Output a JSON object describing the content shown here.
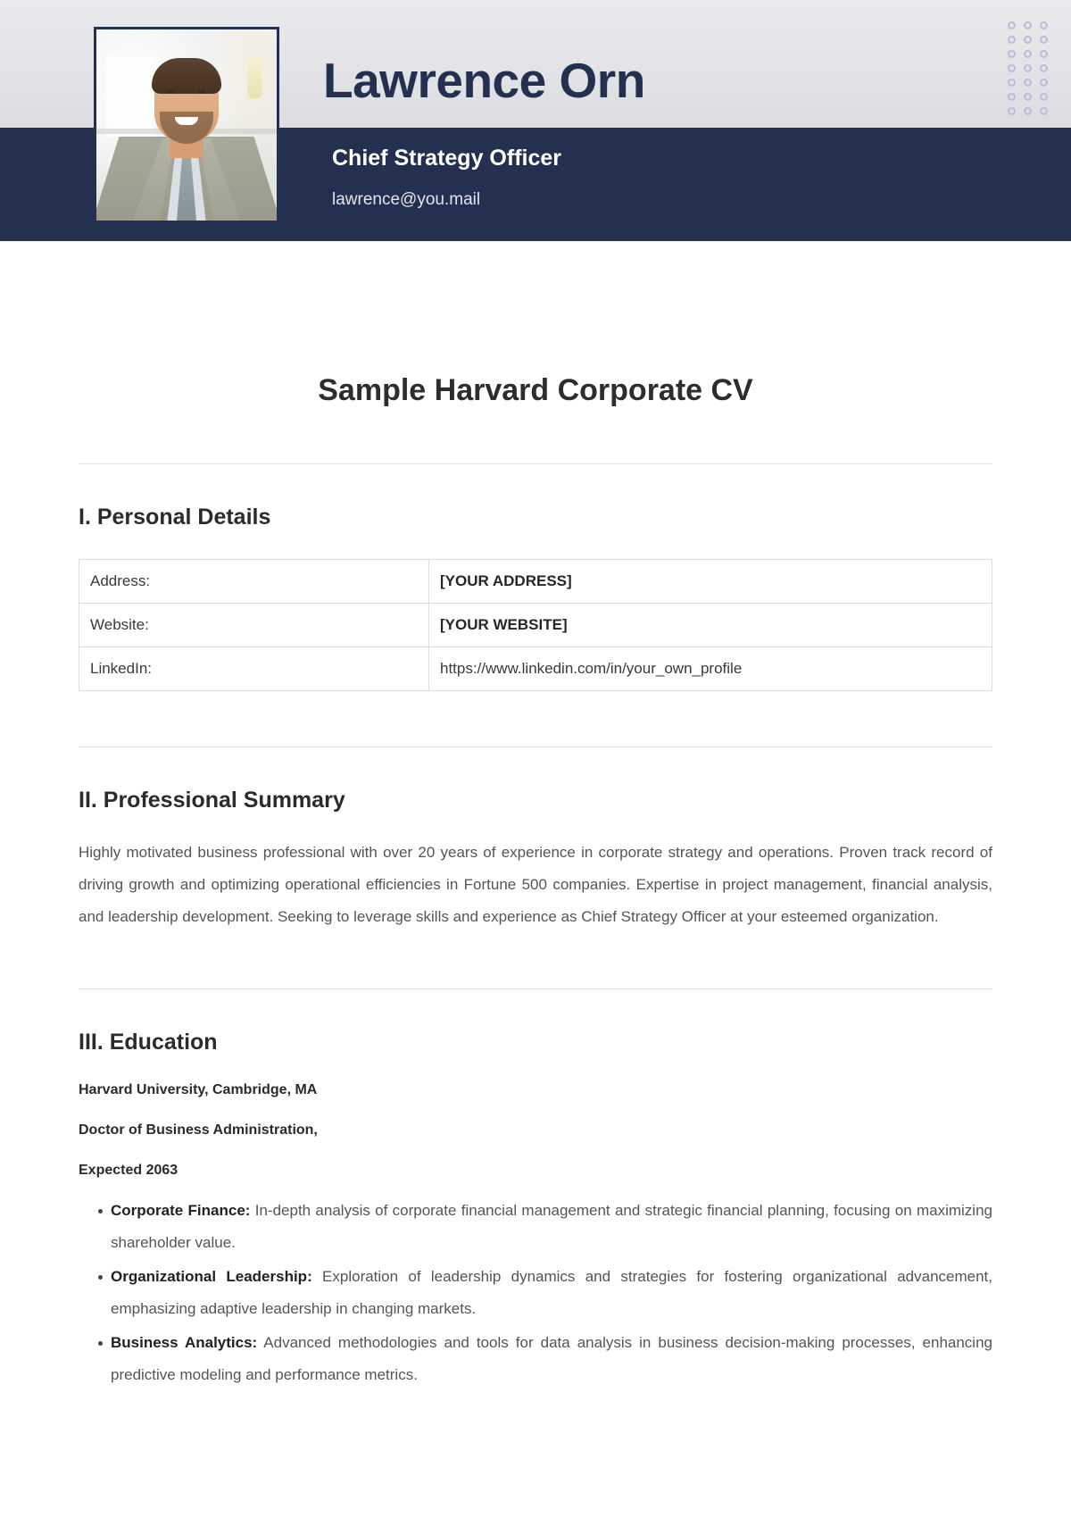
{
  "header": {
    "name": "Lawrence Orn",
    "role": "Chief Strategy Officer",
    "email": "lawrence@you.mail",
    "accent_navy": "#24304f",
    "dot_color": "#c8b4d6",
    "dot_rows": 7,
    "dot_cols": 3
  },
  "document": {
    "title": "Sample Harvard Corporate CV"
  },
  "sections": {
    "personal_details": {
      "heading": "I. Personal Details",
      "rows": [
        {
          "label": "Address:",
          "value": "[YOUR ADDRESS]",
          "bold": true
        },
        {
          "label": "Website:",
          "value": "[YOUR WEBSITE]",
          "bold": true
        },
        {
          "label": "LinkedIn:",
          "value": "https://www.linkedin.com/in/your_own_profile",
          "bold": false
        }
      ]
    },
    "professional_summary": {
      "heading": "II. Professional Summary",
      "body": "Highly motivated business professional with over 20 years of experience in corporate strategy and operations. Proven track record of driving growth and optimizing operational efficiencies in Fortune 500 companies. Expertise in project management, financial analysis, and leadership development. Seeking to leverage skills and experience as Chief Strategy Officer at your esteemed organization."
    },
    "education": {
      "heading": "III. Education",
      "institution": "Harvard University, Cambridge, MA",
      "degree": "Doctor of Business Administration,",
      "expected": "Expected 2063",
      "courses": [
        {
          "name": "Corporate Finance:",
          "description": "In-depth analysis of corporate financial management and strategic financial planning, focusing on maximizing shareholder value."
        },
        {
          "name": "Organizational Leadership:",
          "description": "Exploration of leadership dynamics and strategies for fostering organizational advancement, emphasizing adaptive leadership in changing markets."
        },
        {
          "name": "Business Analytics:",
          "description": "Advanced methodologies and tools for data analysis in business decision-making processes, enhancing predictive modeling and performance metrics."
        }
      ]
    }
  }
}
